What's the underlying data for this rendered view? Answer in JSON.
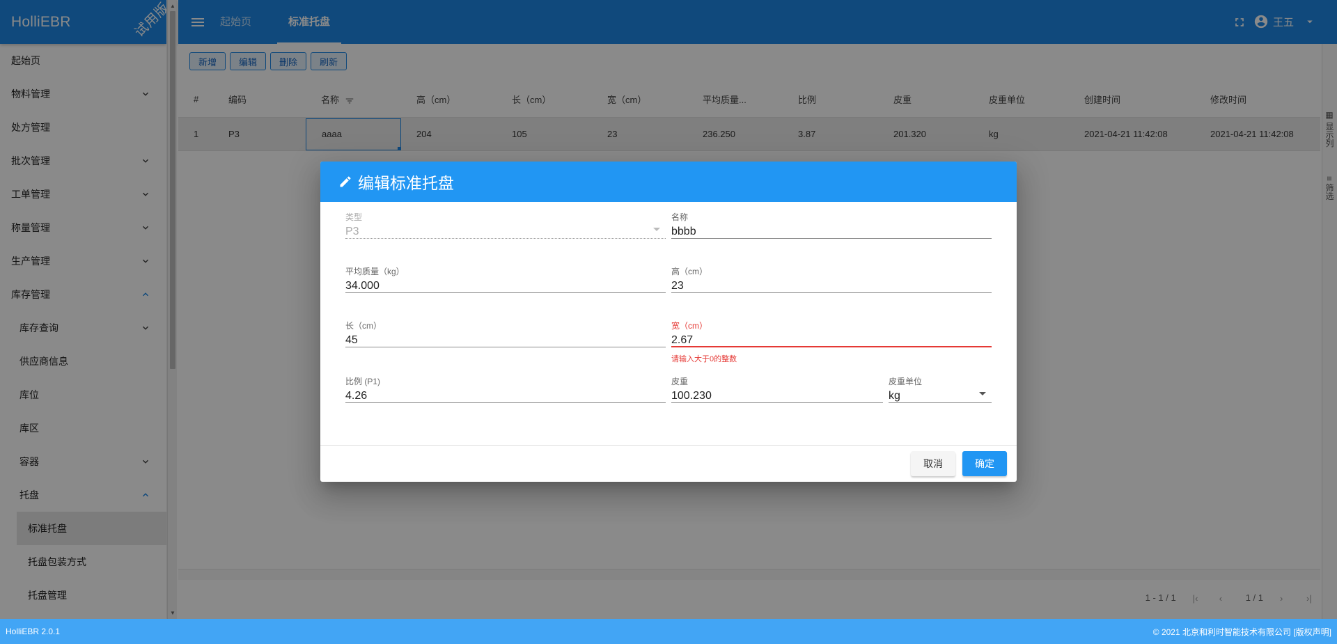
{
  "app": {
    "name": "HolliEBR",
    "trial_tag": "试用版"
  },
  "sidebar": {
    "items": [
      {
        "label": "起始页",
        "level": 0,
        "expandable": false
      },
      {
        "label": "物料管理",
        "level": 0,
        "expandable": true,
        "expanded": false
      },
      {
        "label": "处方管理",
        "level": 0,
        "expandable": false
      },
      {
        "label": "批次管理",
        "level": 0,
        "expandable": true,
        "expanded": false
      },
      {
        "label": "工单管理",
        "level": 0,
        "expandable": true,
        "expanded": false
      },
      {
        "label": "称量管理",
        "level": 0,
        "expandable": true,
        "expanded": false
      },
      {
        "label": "生产管理",
        "level": 0,
        "expandable": true,
        "expanded": false
      },
      {
        "label": "库存管理",
        "level": 0,
        "expandable": true,
        "expanded": true
      },
      {
        "label": "库存查询",
        "level": 1,
        "expandable": true,
        "expanded": false
      },
      {
        "label": "供应商信息",
        "level": 1,
        "expandable": false
      },
      {
        "label": "库位",
        "level": 1,
        "expandable": false
      },
      {
        "label": "库区",
        "level": 1,
        "expandable": false
      },
      {
        "label": "容器",
        "level": 1,
        "expandable": true,
        "expanded": false
      },
      {
        "label": "托盘",
        "level": 1,
        "expandable": true,
        "expanded": true
      },
      {
        "label": "标准托盘",
        "level": 2,
        "expandable": false,
        "active": true
      },
      {
        "label": "托盘包装方式",
        "level": 2,
        "expandable": false
      },
      {
        "label": "托盘管理",
        "level": 2,
        "expandable": false
      }
    ]
  },
  "topbar": {
    "tabs": [
      {
        "label": "起始页",
        "active": false
      },
      {
        "label": "标准托盘",
        "active": true
      }
    ],
    "user_name": "王五"
  },
  "toolbar": {
    "buttons": [
      "新增",
      "编辑",
      "删除",
      "刷新"
    ]
  },
  "table": {
    "headers": [
      "#",
      "编码",
      "名称",
      "高（cm）",
      "长（cm）",
      "宽（cm）",
      "平均质量...",
      "比例",
      "皮重",
      "皮重单位",
      "创建时间",
      "修改时间"
    ],
    "rows": [
      [
        "1",
        "P3",
        "aaaa",
        "204",
        "105",
        "23",
        "236.250",
        "3.87",
        "201.320",
        "kg",
        "2021-04-21 11:42:08",
        "2021-04-21 11:42:08"
      ]
    ]
  },
  "right_rail": {
    "columns_label": "显示列",
    "filter_label": "筛选"
  },
  "pager": {
    "range": "1 - 1 / 1",
    "page": "1 / 1"
  },
  "footer": {
    "version": "HolliEBR 2.0.1",
    "copyright": "© 2021  北京和利时智能技术有限公司 [版权声明]"
  },
  "dialog": {
    "title": "编辑标准托盘",
    "fields": {
      "type": {
        "label": "类型",
        "value": "P3"
      },
      "name": {
        "label": "名称",
        "value": "bbbb"
      },
      "avg_mass": {
        "label": "平均质量（kg）",
        "value": "34.000"
      },
      "height": {
        "label": "高（cm）",
        "value": "23"
      },
      "length": {
        "label": "长（cm）",
        "value": "45"
      },
      "width": {
        "label": "宽（cm）",
        "value": "2.67",
        "error": "请输入大于0的整数"
      },
      "ratio": {
        "label": "比例 (P1)",
        "value": "4.26"
      },
      "tare": {
        "label": "皮重",
        "value": "100.230"
      },
      "tare_unit": {
        "label": "皮重单位",
        "value": "kg"
      }
    },
    "cancel_label": "取消",
    "ok_label": "确定"
  },
  "colors": {
    "primary": "#1e88e5",
    "dialog_header": "#2196f3",
    "footer": "#42a5f5",
    "error": "#e53935"
  }
}
